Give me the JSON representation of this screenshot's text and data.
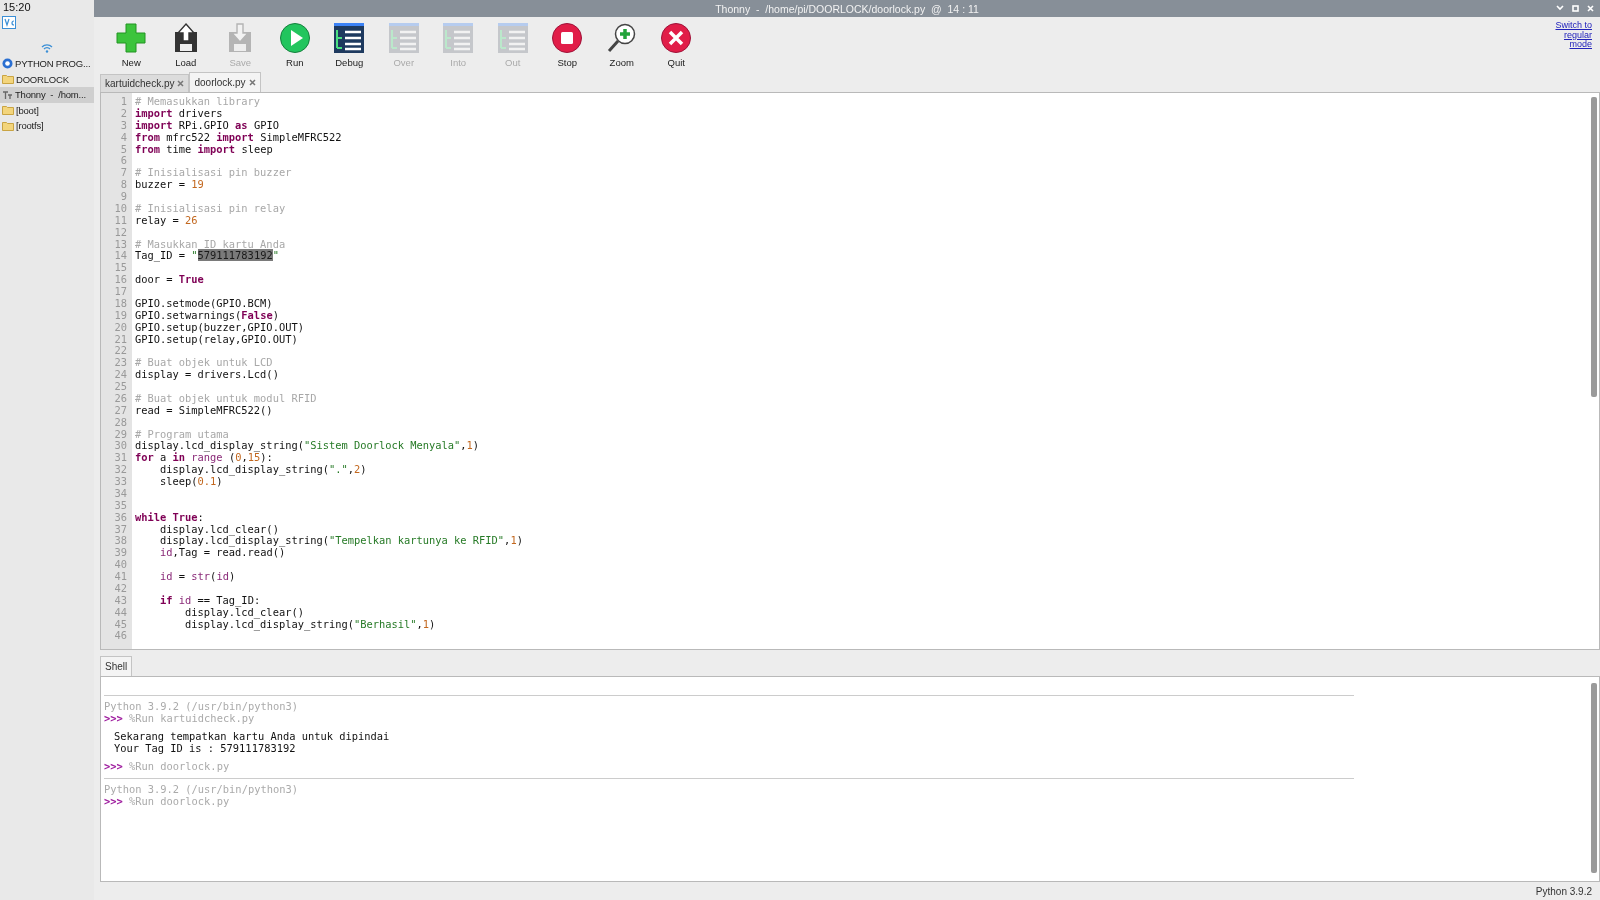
{
  "panel": {
    "time": "15:20",
    "items": [
      {
        "kind": "app",
        "label": "PYTHON PROG...",
        "selected": false
      },
      {
        "kind": "folder",
        "label": "DOORLOCK",
        "selected": false
      },
      {
        "kind": "thonny",
        "label": "Thonny  -  /hom...",
        "selected": true
      },
      {
        "kind": "folder",
        "label": "[boot]",
        "selected": false
      },
      {
        "kind": "folder",
        "label": "[rootfs]",
        "selected": false
      }
    ]
  },
  "window": {
    "title": "Thonny  -  /home/pi/DOORLOCK/doorlock.py  @  14 : 11"
  },
  "toolbar": [
    {
      "kind": "new",
      "label": "New",
      "disabled": false
    },
    {
      "kind": "load",
      "label": "Load",
      "disabled": false
    },
    {
      "kind": "save",
      "label": "Save",
      "disabled": true
    },
    {
      "kind": "run",
      "label": "Run",
      "disabled": false
    },
    {
      "kind": "debug",
      "label": "Debug",
      "disabled": false
    },
    {
      "kind": "over",
      "label": "Over",
      "disabled": true
    },
    {
      "kind": "into",
      "label": "Into",
      "disabled": true
    },
    {
      "kind": "out",
      "label": "Out",
      "disabled": true
    },
    {
      "kind": "stop",
      "label": "Stop",
      "disabled": false
    },
    {
      "kind": "zoom",
      "label": "Zoom",
      "disabled": false
    },
    {
      "kind": "quit",
      "label": "Quit",
      "disabled": false
    }
  ],
  "mode_link": "Switch to regular mode",
  "tabs": [
    {
      "label": "kartuidcheck.py",
      "selected": false
    },
    {
      "label": "doorlock.py",
      "selected": true
    }
  ],
  "editor": {
    "lines": [
      {
        "number": "1",
        "tokens": [
          {
            "kind": "comment",
            "text": "# Memasukkan library"
          }
        ]
      },
      {
        "number": "2",
        "tokens": [
          {
            "kind": "keyword",
            "text": "import"
          },
          {
            "kind": "text",
            "text": " drivers"
          }
        ]
      },
      {
        "number": "3",
        "tokens": [
          {
            "kind": "keyword",
            "text": "import"
          },
          {
            "kind": "text",
            "text": " RPi.GPIO "
          },
          {
            "kind": "keyword",
            "text": "as"
          },
          {
            "kind": "text",
            "text": " GPIO"
          }
        ]
      },
      {
        "number": "4",
        "tokens": [
          {
            "kind": "keyword",
            "text": "from"
          },
          {
            "kind": "text",
            "text": " mfrc522 "
          },
          {
            "kind": "keyword",
            "text": "import"
          },
          {
            "kind": "text",
            "text": " SimpleMFRC522"
          }
        ]
      },
      {
        "number": "5",
        "tokens": [
          {
            "kind": "keyword",
            "text": "from"
          },
          {
            "kind": "text",
            "text": " time "
          },
          {
            "kind": "keyword",
            "text": "import"
          },
          {
            "kind": "text",
            "text": " sleep"
          }
        ]
      },
      {
        "number": "6"
      },
      {
        "number": "7",
        "tokens": [
          {
            "kind": "comment",
            "text": "# Inisialisasi pin buzzer"
          }
        ]
      },
      {
        "number": "8",
        "tokens": [
          {
            "kind": "text",
            "text": "buzzer = "
          },
          {
            "kind": "number",
            "text": "19"
          }
        ]
      },
      {
        "number": "9"
      },
      {
        "number": "10",
        "tokens": [
          {
            "kind": "comment",
            "text": "# Inisialisasi pin relay"
          }
        ]
      },
      {
        "number": "11",
        "tokens": [
          {
            "kind": "text",
            "text": "relay = "
          },
          {
            "kind": "number",
            "text": "26"
          }
        ]
      },
      {
        "number": "12"
      },
      {
        "number": "13",
        "tokens": [
          {
            "kind": "comment",
            "text": "# Masukkan ID kartu Anda"
          }
        ]
      },
      {
        "number": "14",
        "tokens": [
          {
            "kind": "text",
            "text": "Tag_ID = "
          },
          {
            "kind": "string",
            "text": "\""
          },
          {
            "kind": "selected",
            "text": "579111783192"
          },
          {
            "kind": "string",
            "text": "\""
          }
        ]
      },
      {
        "number": "15"
      },
      {
        "number": "16",
        "tokens": [
          {
            "kind": "text",
            "text": "door = "
          },
          {
            "kind": "keyword",
            "text": "True"
          }
        ]
      },
      {
        "number": "17"
      },
      {
        "number": "18",
        "tokens": [
          {
            "kind": "text",
            "text": "GPIO.setmode(GPIO.BCM)"
          }
        ]
      },
      {
        "number": "19",
        "tokens": [
          {
            "kind": "text",
            "text": "GPIO.setwarnings("
          },
          {
            "kind": "keyword",
            "text": "False"
          },
          {
            "kind": "text",
            "text": ")"
          }
        ]
      },
      {
        "number": "20",
        "tokens": [
          {
            "kind": "text",
            "text": "GPIO.setup(buzzer,GPIO.OUT)"
          }
        ]
      },
      {
        "number": "21",
        "tokens": [
          {
            "kind": "text",
            "text": "GPIO.setup(relay,GPIO.OUT)"
          }
        ]
      },
      {
        "number": "22"
      },
      {
        "number": "23",
        "tokens": [
          {
            "kind": "comment",
            "text": "# Buat objek untuk LCD"
          }
        ]
      },
      {
        "number": "24",
        "tokens": [
          {
            "kind": "text",
            "text": "display = drivers.Lcd()"
          }
        ]
      },
      {
        "number": "25"
      },
      {
        "number": "26",
        "tokens": [
          {
            "kind": "comment",
            "text": "# Buat objek untuk modul RFID"
          }
        ]
      },
      {
        "number": "27",
        "tokens": [
          {
            "kind": "text",
            "text": "read = SimpleMFRC522()"
          }
        ]
      },
      {
        "number": "28"
      },
      {
        "number": "29",
        "tokens": [
          {
            "kind": "comment",
            "text": "# Program utama"
          }
        ]
      },
      {
        "number": "30",
        "tokens": [
          {
            "kind": "text",
            "text": "display.lcd_display_string("
          },
          {
            "kind": "string",
            "text": "\"Sistem Doorlock Menyala\""
          },
          {
            "kind": "text",
            "text": ","
          },
          {
            "kind": "number",
            "text": "1"
          },
          {
            "kind": "text",
            "text": ")"
          }
        ]
      },
      {
        "number": "31",
        "tokens": [
          {
            "kind": "keyword",
            "text": "for"
          },
          {
            "kind": "text",
            "text": " a "
          },
          {
            "kind": "keyword",
            "text": "in"
          },
          {
            "kind": "name",
            "text": " range"
          },
          {
            "kind": "text",
            "text": " ("
          },
          {
            "kind": "number",
            "text": "0"
          },
          {
            "kind": "text",
            "text": ","
          },
          {
            "kind": "number",
            "text": "15"
          },
          {
            "kind": "text",
            "text": "):"
          }
        ]
      },
      {
        "number": "32",
        "tokens": [
          {
            "kind": "text",
            "text": "    display.lcd_display_string("
          },
          {
            "kind": "string",
            "text": "\".\""
          },
          {
            "kind": "text",
            "text": ","
          },
          {
            "kind": "number",
            "text": "2"
          },
          {
            "kind": "text",
            "text": ")"
          }
        ]
      },
      {
        "number": "33",
        "tokens": [
          {
            "kind": "text",
            "text": "    sleep("
          },
          {
            "kind": "number",
            "text": "0.1"
          },
          {
            "kind": "text",
            "text": ")"
          }
        ]
      },
      {
        "number": "34"
      },
      {
        "number": "35"
      },
      {
        "number": "36",
        "tokens": [
          {
            "kind": "keyword",
            "text": "while True"
          },
          {
            "kind": "text",
            "text": ":"
          }
        ]
      },
      {
        "number": "37",
        "tokens": [
          {
            "kind": "text",
            "text": "    display.lcd_clear()"
          }
        ]
      },
      {
        "number": "38",
        "tokens": [
          {
            "kind": "text",
            "text": "    display.lcd_display_string("
          },
          {
            "kind": "string",
            "text": "\"Tempelkan kartunya ke RFID\""
          },
          {
            "kind": "text",
            "text": ","
          },
          {
            "kind": "number",
            "text": "1"
          },
          {
            "kind": "text",
            "text": ")"
          }
        ]
      },
      {
        "number": "39",
        "tokens": [
          {
            "kind": "name",
            "text": "    id"
          },
          {
            "kind": "text",
            "text": ",Tag = read.read()"
          }
        ]
      },
      {
        "number": "40"
      },
      {
        "number": "41",
        "tokens": [
          {
            "kind": "name",
            "text": "    id"
          },
          {
            "kind": "text",
            "text": " = "
          },
          {
            "kind": "name",
            "text": "str"
          },
          {
            "kind": "text",
            "text": "("
          },
          {
            "kind": "name",
            "text": "id"
          },
          {
            "kind": "text",
            "text": ")"
          }
        ]
      },
      {
        "number": "42"
      },
      {
        "number": "43",
        "tokens": [
          {
            "kind": "keyword",
            "text": "    if"
          },
          {
            "kind": "name",
            "text": " id"
          },
          {
            "kind": "text",
            "text": " == Tag_ID:"
          }
        ]
      },
      {
        "number": "44",
        "tokens": [
          {
            "kind": "text",
            "text": "        display.lcd_clear()"
          }
        ]
      },
      {
        "number": "45",
        "tokens": [
          {
            "kind": "text",
            "text": "        display.lcd_display_string("
          },
          {
            "kind": "string",
            "text": "\"Berhasil\""
          },
          {
            "kind": "text",
            "text": ","
          },
          {
            "kind": "number",
            "text": "1"
          },
          {
            "kind": "text",
            "text": ")"
          }
        ]
      },
      {
        "number": "46"
      }
    ]
  },
  "shell": {
    "tab": "Shell",
    "sessions": [
      {
        "banner": "Python 3.9.2 (/usr/bin/python3)",
        "runs": [
          {
            "prompt": ">>>",
            "command": "%Run kartuidcheck.py",
            "output": [
              "Sekarang tempatkan kartu Anda untuk dipindai",
              "Your Tag ID is : 579111783192"
            ]
          },
          {
            "prompt": ">>>",
            "command": "%Run doorlock.py"
          }
        ]
      },
      {
        "banner": "Python 3.9.2 (/usr/bin/python3)",
        "runs": [
          {
            "prompt": ">>>",
            "command": "%Run doorlock.py"
          }
        ]
      }
    ]
  },
  "status_bar": "Python 3.9.2"
}
